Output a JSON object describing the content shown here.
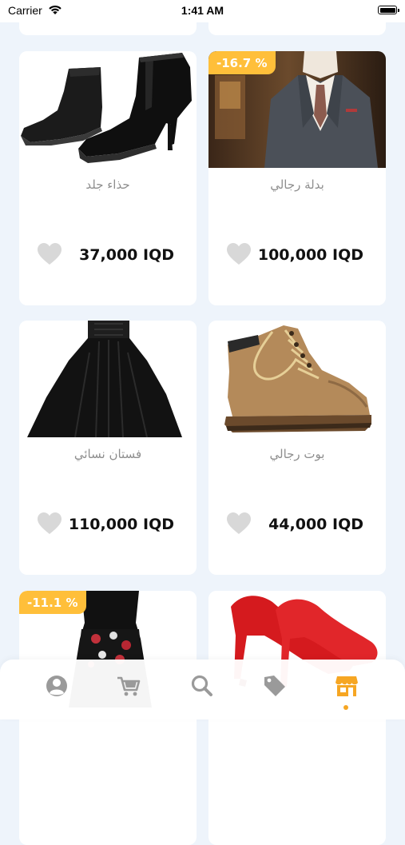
{
  "status_bar": {
    "carrier": "Carrier",
    "time": "1:41 AM"
  },
  "products": [
    {
      "name": "حذاء جلد",
      "price": "37,000 IQD",
      "discount": "",
      "image": "black-leather-boots"
    },
    {
      "name": "بدلة رجالي",
      "price": "100,000 IQD",
      "discount": "-16.7 %",
      "image": "mens-suit"
    },
    {
      "name": "فستان نسائي",
      "price": "110,000 IQD",
      "discount": "",
      "image": "black-dress"
    },
    {
      "name": "بوت رجالي",
      "price": "44,000 IQD",
      "discount": "",
      "image": "brown-work-boots"
    },
    {
      "name": "",
      "price": "",
      "discount": "-11.1 %",
      "image": "floral-dress"
    },
    {
      "name": "",
      "price": "",
      "discount": "",
      "image": "red-high-heels"
    }
  ],
  "bottom_nav": {
    "items": [
      "profile-icon",
      "cart-icon",
      "search-icon",
      "offers-tag-icon",
      "store-icon"
    ],
    "active": "store-icon",
    "accent_color": "#f6a623",
    "inactive_color": "#9a9a9a"
  },
  "colors": {
    "background": "#eef4fb",
    "badge": "#ffbf3a",
    "heart": "#d8d8d8"
  }
}
